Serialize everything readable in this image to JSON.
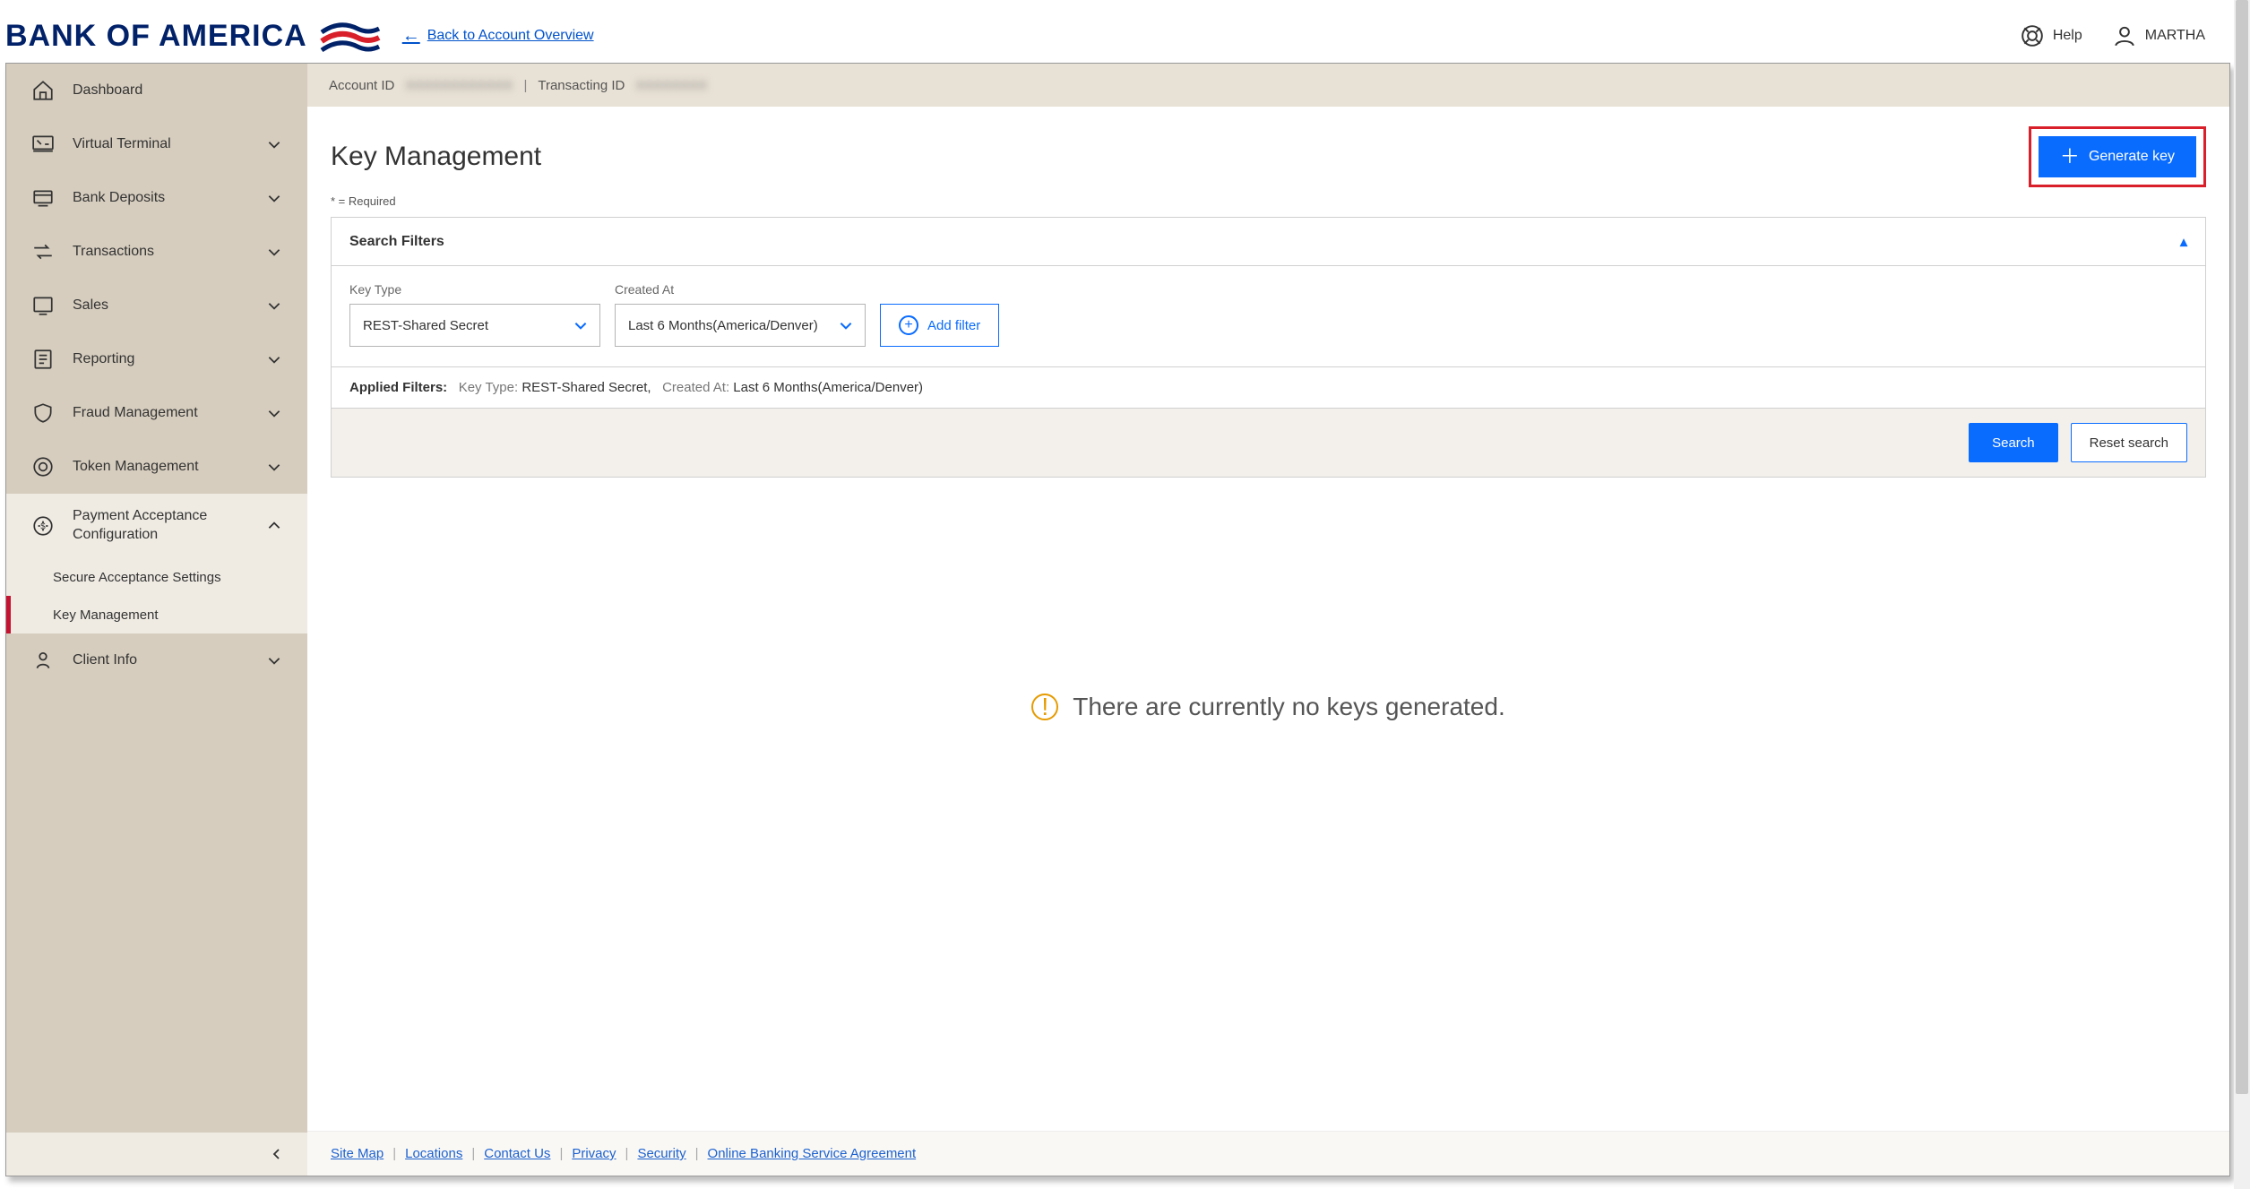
{
  "brand": {
    "name": "BANK OF AMERICA",
    "back_link": "Back to Account Overview"
  },
  "header_right": {
    "help": "Help",
    "user": "MARTHA"
  },
  "idbar": {
    "account_label": "Account ID",
    "account_value": "XXXXXXXXXXXX",
    "transacting_label": "Transacting ID",
    "transacting_value": "XXXXXXXX"
  },
  "sidebar": {
    "items": [
      {
        "label": "Dashboard",
        "expandable": false
      },
      {
        "label": "Virtual Terminal",
        "expandable": true
      },
      {
        "label": "Bank Deposits",
        "expandable": true
      },
      {
        "label": "Transactions",
        "expandable": true
      },
      {
        "label": "Sales",
        "expandable": true
      },
      {
        "label": "Reporting",
        "expandable": true
      },
      {
        "label": "Fraud Management",
        "expandable": true
      },
      {
        "label": "Token Management",
        "expandable": true
      },
      {
        "label": "Payment Acceptance Configuration",
        "expandable": true,
        "expanded": true
      },
      {
        "label": "Client Info",
        "expandable": true
      }
    ],
    "subitems": {
      "secure_acceptance": "Secure Acceptance Settings",
      "key_management": "Key Management"
    }
  },
  "page": {
    "title": "Key Management",
    "required_note": "* = Required",
    "generate_key_label": "Generate key"
  },
  "filters": {
    "panel_title": "Search Filters",
    "key_type_label": "Key Type",
    "key_type_value": "REST-Shared Secret",
    "created_at_label": "Created At",
    "created_at_value": "Last 6 Months(America/Denver)",
    "add_filter_label": "Add filter",
    "applied_label": "Applied Filters:",
    "applied_key_type_k": "Key Type:",
    "applied_key_type_v": "REST-Shared Secret,",
    "applied_created_k": "Created At:",
    "applied_created_v": "Last 6 Months(America/Denver)",
    "search_label": "Search",
    "reset_label": "Reset search"
  },
  "empty_state": {
    "message": "There are currently no keys generated."
  },
  "footer": {
    "links": {
      "site_map": "Site Map",
      "locations": "Locations",
      "contact": "Contact Us",
      "privacy": "Privacy",
      "security": "Security",
      "agreement": "Online Banking Service Agreement"
    }
  }
}
